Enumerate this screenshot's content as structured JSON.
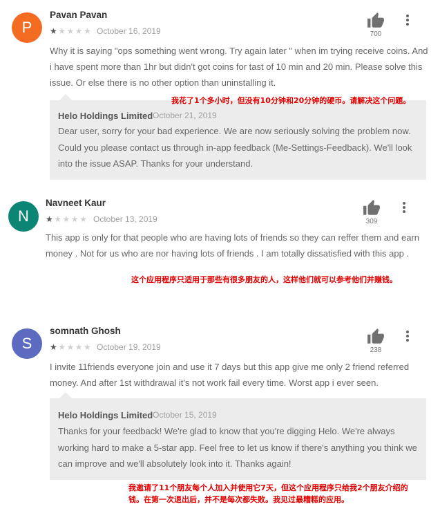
{
  "reviews": [
    {
      "avatar_letter": "P",
      "avatar_color": "#f36c21",
      "author": "Pavan Pavan",
      "rating": 1,
      "max_rating": 5,
      "date": "October 16, 2019",
      "helpful_count": "700",
      "text": "Why it is saying \"ops something went wrong. Try again later \" when im trying receive coins. And i have spent more than 1hr but didn't got coins for tast of 10 min and 20 min. Please solve this issue. Or else there is no other option than uninstalling it.",
      "annotation": "我花了1个多小时，但没有10分钟和20分钟的硬币。请解决这个问题。",
      "reply": {
        "developer": "Helo Holdings Limited",
        "date": "October 21, 2019",
        "text": "Dear user, sorry for your bad experience. We are now seriously solving the problem now. Could you please contact us through in-app feedback (Me-Settings-Feedback). We'll look into the issue ASAP. Thanks for your understand."
      }
    },
    {
      "avatar_letter": "N",
      "avatar_color": "#0b8574",
      "author": "Navneet Kaur",
      "rating": 1,
      "max_rating": 5,
      "date": "October 13, 2019",
      "helpful_count": "309",
      "text": "This app is only for that people who are having lots of friends so they can reffer them and earn money . Not for us who are nor having lots of friends . I am totally dissatisfied with this app .",
      "annotation": "这个应用程序只适用于那些有很多朋友的人，这样他们就可以参考他们并赚钱。"
    },
    {
      "avatar_letter": "S",
      "avatar_color": "#5c6bc0",
      "author": "somnath Ghosh",
      "rating": 1,
      "max_rating": 5,
      "date": "October 19, 2019",
      "helpful_count": "238",
      "text": "I invite 11friends everyone join and use it 7 days but this app give me only 2 friend referred money. And after 1st withdrawal it's not work fail every time. Worst app i ever seen.",
      "annotation": "我邀请了11个朋友每个人加入并使用它7天，但这个应用程序只给我2个朋友介绍的钱。在第一次退出后，并不是每次都失败。我见过最糟糕的应用。",
      "reply": {
        "developer": "Helo Holdings Limited",
        "date": "October 15, 2019",
        "text": "Thanks for your feedback! We're glad to know that you're digging Helo. We're always working hard to make a 5-star app. Feel free to let us know if there's anything you think we can improve and we'll absolutely look into it. Thanks again!"
      }
    }
  ],
  "icons": {
    "helpful": "thumbs-up-icon",
    "menu": "more-vert-icon",
    "star": "star-icon"
  }
}
